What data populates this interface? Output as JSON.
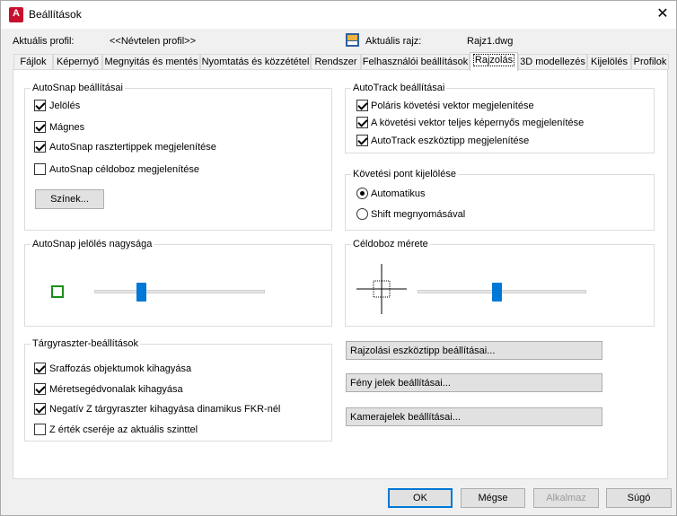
{
  "window": {
    "title": "Beállítások",
    "close": "✕"
  },
  "profile": {
    "current_label": "Aktuális profil:",
    "current_value": "<<Névtelen profil>>",
    "drawing_label": "Aktuális rajz:",
    "drawing_value": "Rajz1.dwg"
  },
  "tabs": [
    {
      "label": "Fájlok"
    },
    {
      "label": "Képernyő"
    },
    {
      "label": "Megnyitás és mentés"
    },
    {
      "label": "Nyomtatás és közzététel"
    },
    {
      "label": "Rendszer"
    },
    {
      "label": "Felhasználói beállítások"
    },
    {
      "label": "Rajzolás"
    },
    {
      "label": "3D modellezés"
    },
    {
      "label": "Kijelölés"
    },
    {
      "label": "Profilok"
    }
  ],
  "active_tab": "Rajzolás",
  "autosnap": {
    "title": "AutoSnap beállításai",
    "options": [
      {
        "label": "Jelölés",
        "checked": true
      },
      {
        "label": "Mágnes",
        "checked": true
      },
      {
        "label": "AutoSnap rasztertippek megjelenítése",
        "checked": true
      },
      {
        "label": "AutoSnap céldoboz megjelenítése",
        "checked": false
      }
    ],
    "colors_button": "Színek..."
  },
  "autotrack": {
    "title": "AutoTrack beállításai",
    "options": [
      {
        "label": "Poláris követési vektor megjelenítése",
        "checked": true
      },
      {
        "label": "A követési vektor teljes képernyős megjelenítése",
        "checked": true
      },
      {
        "label": "AutoTrack eszköztipp megjelenítése",
        "checked": true
      }
    ]
  },
  "tracking_point": {
    "title": "Követési pont kijelölése",
    "options": [
      {
        "label": "Automatikus",
        "selected": true
      },
      {
        "label": "Shift megnyomásával",
        "selected": false
      }
    ]
  },
  "marker_size": {
    "title": "AutoSnap jelölés nagysága",
    "level": 0.27,
    "marker_color": "#1a8f1a"
  },
  "aperture_size": {
    "title": "Céldoboz mérete",
    "level": 0.47
  },
  "object_snap": {
    "title": "Tárgyraszter-beállítások",
    "options": [
      {
        "label": "Sraffozás objektumok kihagyása",
        "checked": true
      },
      {
        "label": "Méretsegédvonalak kihagyása",
        "checked": true
      },
      {
        "label": "Negatív Z tárgyraszter kihagyása dinamikus FKR-nél",
        "checked": true
      },
      {
        "label": "Z érték cseréje az aktuális szinttel",
        "checked": false
      }
    ]
  },
  "side_buttons": [
    "Rajzolási eszköztipp beállításai...",
    "Fény jelek beállításai...",
    "Kamerajelek beállításai..."
  ],
  "footer": {
    "ok": "OK",
    "cancel": "Mégse",
    "apply": "Alkalmaz",
    "help": "Súgó"
  },
  "colors": {
    "accent": "#0078d7",
    "app_icon": "#c8102e"
  }
}
